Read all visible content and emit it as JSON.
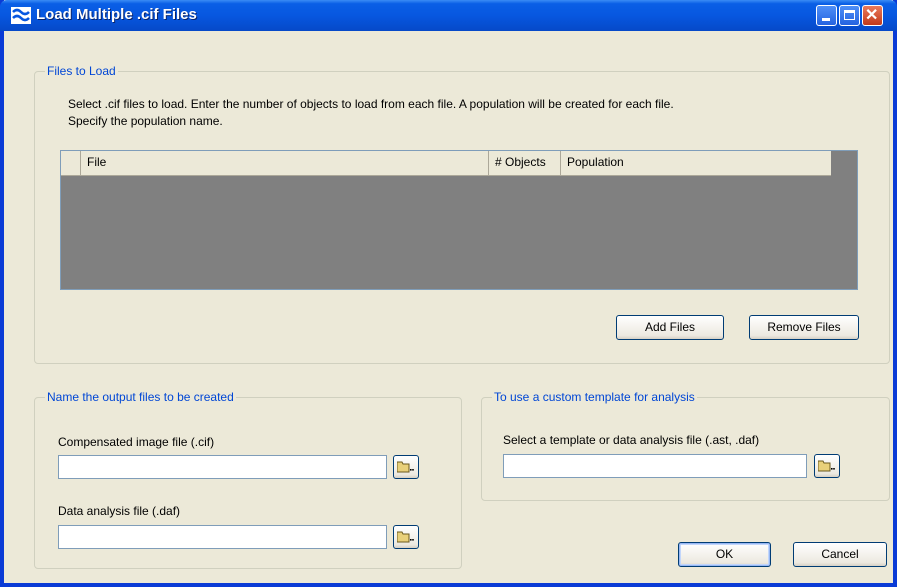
{
  "window": {
    "title": "Load Multiple .cif Files",
    "controls": {
      "minimize": "minimize",
      "maximize": "maximize",
      "close": "✕"
    }
  },
  "files_group": {
    "legend": "Files to Load",
    "instruction_line1": "Select .cif files to load.  Enter the number of objects to load from each file.  A population will be created for each file.",
    "instruction_line2": "Specify the population name.",
    "columns": [
      "File",
      "# Objects",
      "Population"
    ],
    "add_button": "Add Files",
    "remove_button": "Remove Files"
  },
  "output_group": {
    "legend": "Name the output files to be created",
    "compensated_label": "Compensated image file (.cif)",
    "compensated_value": "",
    "daf_label": "Data analysis file (.daf)",
    "daf_value": "",
    "browse_label": "..."
  },
  "template_group": {
    "legend": "To use a custom template for analysis",
    "select_label": "Select a template or data analysis file (.ast, .daf)",
    "template_value": "",
    "browse_label": "..."
  },
  "footer": {
    "ok": "OK",
    "cancel": "Cancel"
  },
  "colors": {
    "accent": "#0046d5",
    "titlebar": "#0757e0",
    "grid_bg": "#808080",
    "window_bg": "#ece9d8"
  },
  "icons": {
    "folder": "folder-icon",
    "app": "app-icon"
  }
}
